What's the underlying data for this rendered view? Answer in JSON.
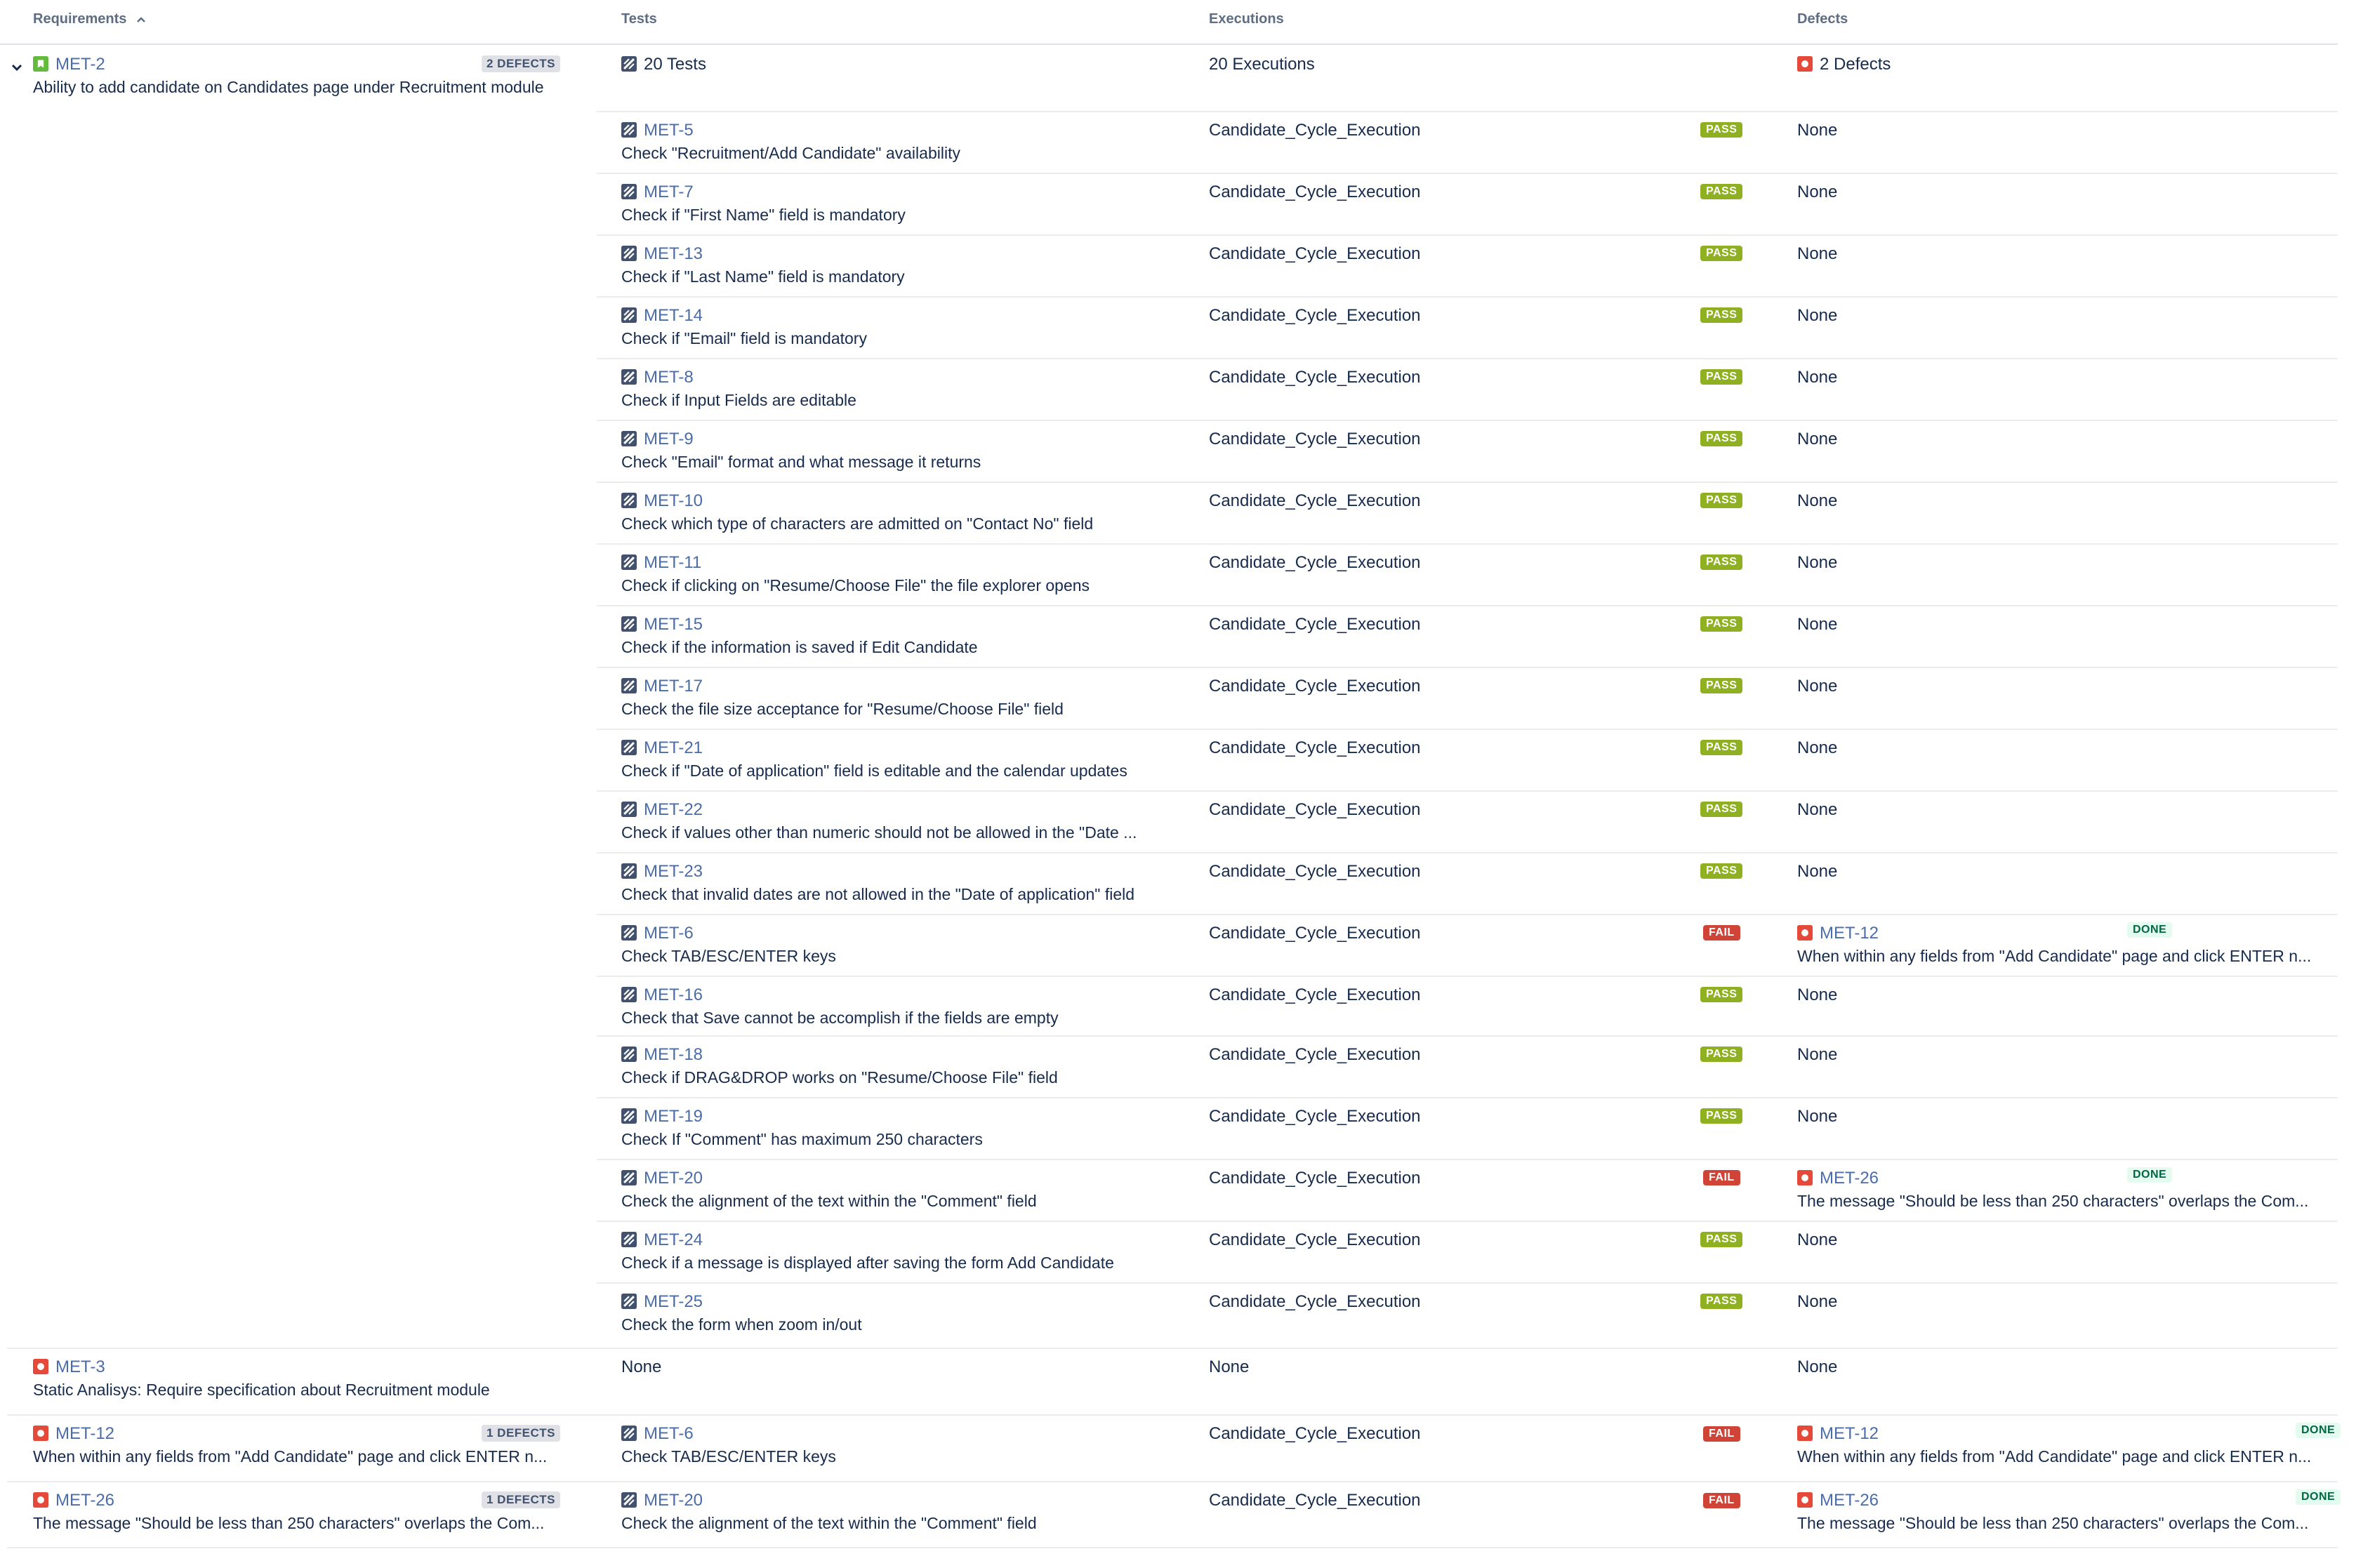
{
  "columns": {
    "requirements": "Requirements",
    "tests": "Tests",
    "executions": "Executions",
    "defects": "Defects"
  },
  "colors": {
    "pass": "#8fb021",
    "fail": "#d04437",
    "done_text": "#006644",
    "link": "#4a6ca8"
  },
  "icons": {
    "story": "story-icon",
    "bug": "bug-icon",
    "test": "test-icon",
    "expand": "chevron-down-icon",
    "sort": "sort-ascending-icon"
  },
  "groups": [
    {
      "requirement": {
        "key": "MET-2",
        "summary": "Ability to add candidate on Candidates page under Recruitment module",
        "defects_badge": "2 DEFECTS",
        "type": "story"
      },
      "tests_summary": "20 Tests",
      "executions_summary": "20 Executions",
      "defects_summary": "2 Defects",
      "rows": [
        {
          "key": "MET-5",
          "summary": "Check \"Recruitment/Add Candidate\" availability",
          "execution": "Candidate_Cycle_Execution",
          "status": "PASS",
          "defect": "None"
        },
        {
          "key": "MET-7",
          "summary": "Check if \"First Name\" field is mandatory",
          "execution": "Candidate_Cycle_Execution",
          "status": "PASS",
          "defect": "None"
        },
        {
          "key": "MET-13",
          "summary": "Check if \"Last Name\" field is mandatory",
          "execution": "Candidate_Cycle_Execution",
          "status": "PASS",
          "defect": "None"
        },
        {
          "key": "MET-14",
          "summary": "Check if \"Email\" field is mandatory",
          "execution": "Candidate_Cycle_Execution",
          "status": "PASS",
          "defect": "None"
        },
        {
          "key": "MET-8",
          "summary": "Check if Input Fields are editable",
          "execution": "Candidate_Cycle_Execution",
          "status": "PASS",
          "defect": "None"
        },
        {
          "key": "MET-9",
          "summary": "Check \"Email\" format and what message it returns",
          "execution": "Candidate_Cycle_Execution",
          "status": "PASS",
          "defect": "None"
        },
        {
          "key": "MET-10",
          "summary": "Check which type of characters are admitted on \"Contact No\" field",
          "execution": "Candidate_Cycle_Execution",
          "status": "PASS",
          "defect": "None"
        },
        {
          "key": "MET-11",
          "summary": "Check if clicking on \"Resume/Choose File\" the file explorer opens",
          "execution": "Candidate_Cycle_Execution",
          "status": "PASS",
          "defect": "None"
        },
        {
          "key": "MET-15",
          "summary": "Check if the information is saved if Edit Candidate",
          "execution": "Candidate_Cycle_Execution",
          "status": "PASS",
          "defect": "None"
        },
        {
          "key": "MET-17",
          "summary": "Check the file size acceptance for \"Resume/Choose File\" field",
          "execution": "Candidate_Cycle_Execution",
          "status": "PASS",
          "defect": "None"
        },
        {
          "key": "MET-21",
          "summary": "Check if \"Date of application\" field is editable and the calendar updates",
          "execution": "Candidate_Cycle_Execution",
          "status": "PASS",
          "defect": "None"
        },
        {
          "key": "MET-22",
          "summary": "Check if values other than numeric should not be allowed in the \"Date ...",
          "execution": "Candidate_Cycle_Execution",
          "status": "PASS",
          "defect": "None"
        },
        {
          "key": "MET-23",
          "summary": "Check that invalid dates are not allowed in the \"Date of application\" field",
          "execution": "Candidate_Cycle_Execution",
          "status": "PASS",
          "defect": "None"
        },
        {
          "key": "MET-6",
          "summary": "Check TAB/ESC/ENTER keys",
          "execution": "Candidate_Cycle_Execution",
          "status": "FAIL",
          "defect": {
            "key": "MET-12",
            "status": "DONE",
            "summary": "When within any fields from \"Add Candidate\" page and click ENTER n..."
          }
        },
        {
          "key": "MET-16",
          "summary": "Check that Save cannot be accomplish if the fields are empty",
          "execution": "Candidate_Cycle_Execution",
          "status": "PASS",
          "defect": "None"
        },
        {
          "key": "MET-18",
          "summary": "Check if DRAG&DROP works on \"Resume/Choose File\" field",
          "execution": "Candidate_Cycle_Execution",
          "status": "PASS",
          "defect": "None"
        },
        {
          "key": "MET-19",
          "summary": "Check If \"Comment\" has maximum 250 characters",
          "execution": "Candidate_Cycle_Execution",
          "status": "PASS",
          "defect": "None"
        },
        {
          "key": "MET-20",
          "summary": "Check the alignment of the text within the \"Comment\" field",
          "execution": "Candidate_Cycle_Execution",
          "status": "FAIL",
          "defect": {
            "key": "MET-26",
            "status": "DONE",
            "summary": "The message \"Should be less than 250 characters\" overlaps the Com..."
          }
        },
        {
          "key": "MET-24",
          "summary": "Check if a message is displayed after saving the form Add Candidate",
          "execution": "Candidate_Cycle_Execution",
          "status": "PASS",
          "defect": "None"
        },
        {
          "key": "MET-25",
          "summary": "Check the form when zoom in/out",
          "execution": "Candidate_Cycle_Execution",
          "status": "PASS",
          "defect": "None"
        }
      ]
    },
    {
      "requirement": {
        "key": "MET-3",
        "summary": "Static Analisys: Require specification about Recruitment module",
        "defects_badge": "",
        "type": "bug"
      },
      "tests": "None",
      "executions": "None",
      "defects": "None"
    },
    {
      "requirement": {
        "key": "MET-12",
        "summary": "When within any fields from \"Add Candidate\" page and click ENTER n...",
        "defects_badge": "1 DEFECTS",
        "type": "bug"
      },
      "test": {
        "key": "MET-6",
        "summary": "Check TAB/ESC/ENTER keys"
      },
      "execution": "Candidate_Cycle_Execution",
      "status": "FAIL",
      "defect": {
        "key": "MET-12",
        "status": "DONE",
        "summary": "When within any fields from \"Add Candidate\" page and click ENTER n..."
      }
    },
    {
      "requirement": {
        "key": "MET-26",
        "summary": "The message \"Should be less than 250 characters\" overlaps the Com...",
        "defects_badge": "1 DEFECTS",
        "type": "bug"
      },
      "test": {
        "key": "MET-20",
        "summary": "Check the alignment of the text within the \"Comment\" field"
      },
      "execution": "Candidate_Cycle_Execution",
      "status": "FAIL",
      "defect": {
        "key": "MET-26",
        "status": "DONE",
        "summary": "The message \"Should be less than 250 characters\" overlaps the Com..."
      }
    }
  ]
}
